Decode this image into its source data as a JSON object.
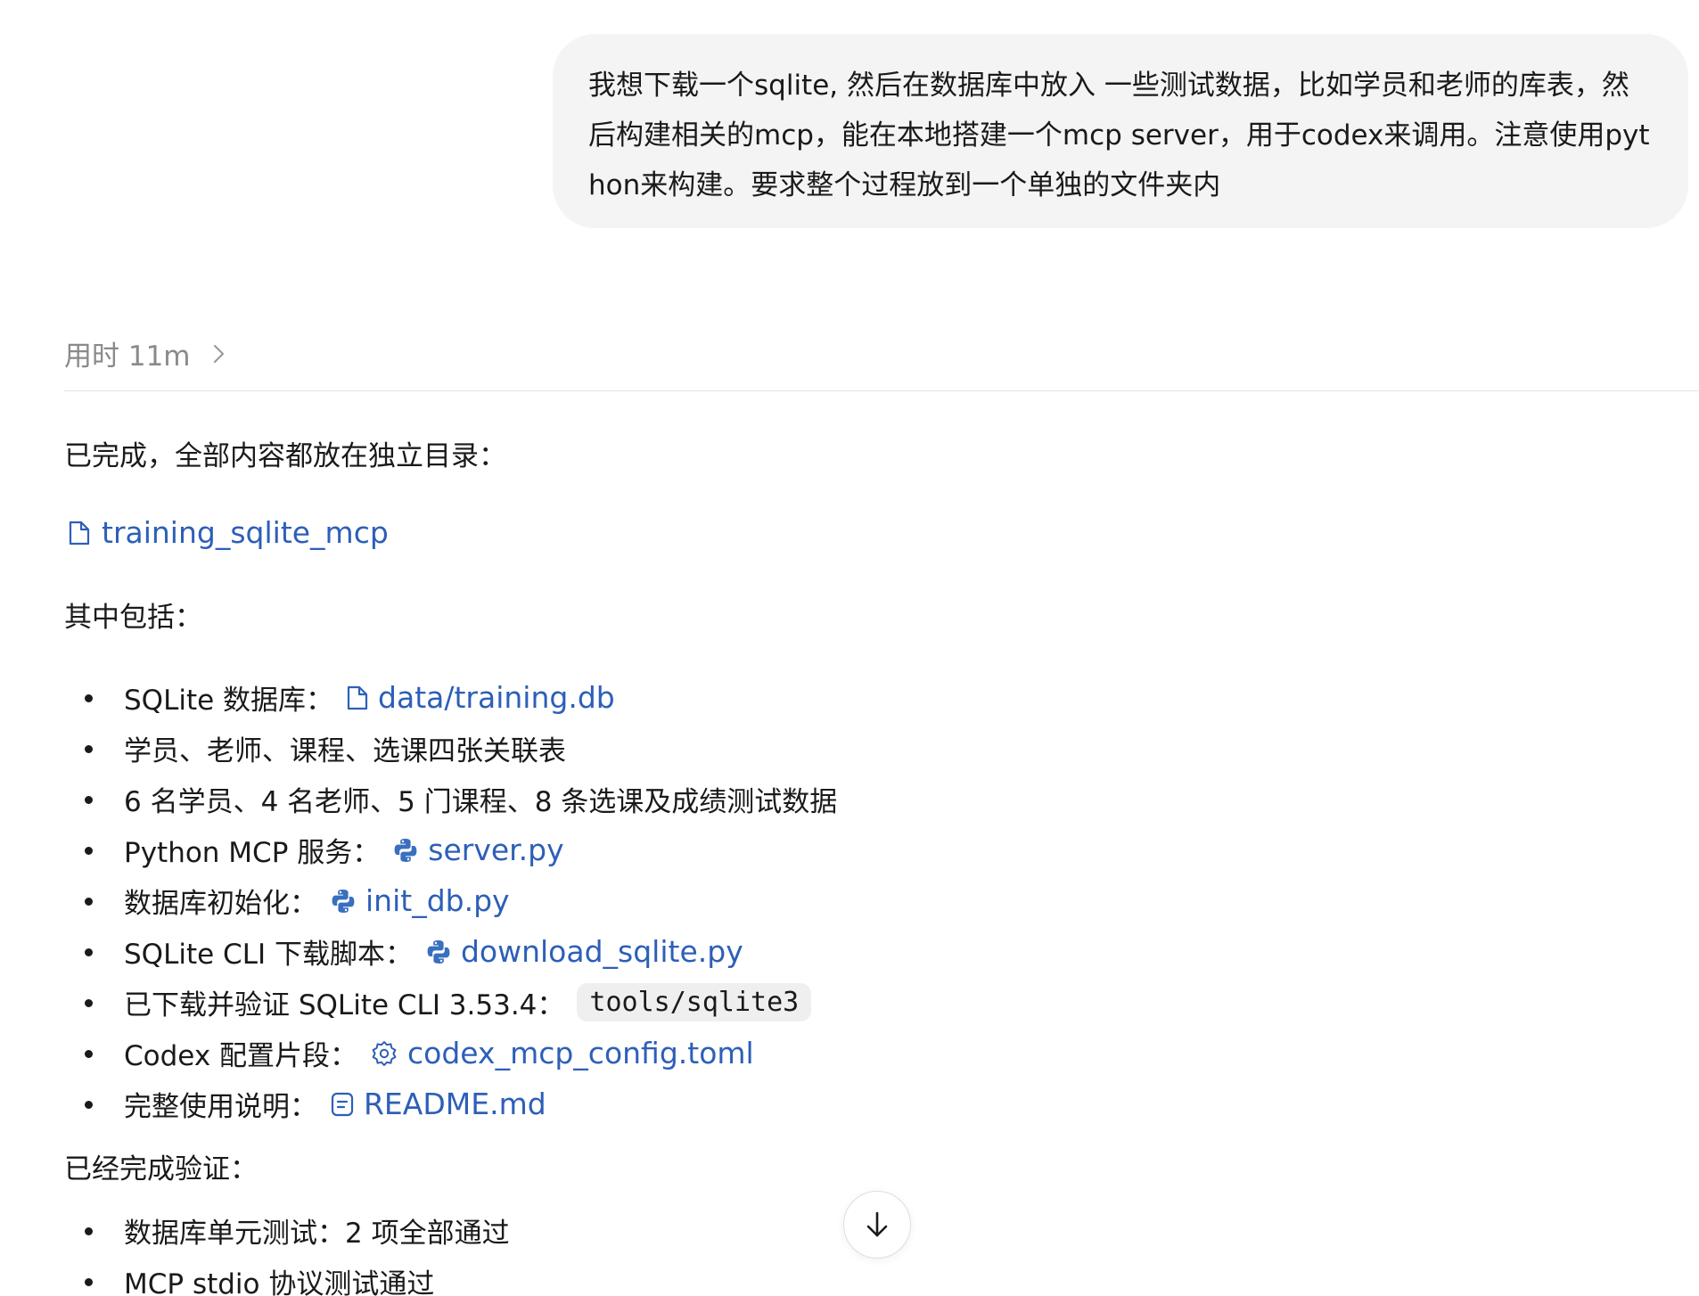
{
  "user_message": {
    "text": "我想下载一个sqlite, 然后在数据库中放入 一些测试数据，比如学员和老师的库表，然后构建相关的mcp，能在本地搭建一个mcp server，用于codex来调用。注意使用python来构建。要求整个过程放到一个单独的文件夹内"
  },
  "duration": {
    "label": "用时 11m",
    "icon": "chevron-right-icon"
  },
  "answer": {
    "intro": "已完成，全部内容都放在独立目录：",
    "folder_link": {
      "label": "training_sqlite_mcp",
      "icon": "file-icon"
    },
    "includes_heading": "其中包括：",
    "items": [
      {
        "text": "SQLite 数据库：",
        "link": "data/training.db",
        "icon": "file-icon"
      },
      {
        "text": "学员、老师、课程、选课四张关联表"
      },
      {
        "text": "6 名学员、4 名老师、5 门课程、8 条选课及成绩测试数据"
      },
      {
        "text": "Python MCP 服务：",
        "link": "server.py",
        "icon": "python-icon"
      },
      {
        "text": "数据库初始化：",
        "link": "init_db.py",
        "icon": "python-icon"
      },
      {
        "text": "SQLite CLI 下载脚本：",
        "link": "download_sqlite.py",
        "icon": "python-icon"
      },
      {
        "text": "已下载并验证 SQLite CLI 3.53.4：",
        "code": "tools/sqlite3"
      },
      {
        "text": "Codex 配置片段：",
        "link": "codex_mcp_config.toml",
        "icon": "gear-icon"
      },
      {
        "text": "完整使用说明：",
        "link": "README.md",
        "icon": "document-icon"
      }
    ],
    "verified_heading": "已经完成验证：",
    "verified_items": [
      {
        "text": "数据库单元测试：2 项全部通过"
      },
      {
        "text": "MCP stdio 协议测试通过"
      }
    ]
  },
  "scroll_button": {
    "icon": "arrow-down-icon"
  },
  "colors": {
    "link": "#2d5fb8",
    "python_blue": "#3a6fbf",
    "bubble_bg": "#f4f4f4",
    "muted_text": "#8a8a8a"
  }
}
